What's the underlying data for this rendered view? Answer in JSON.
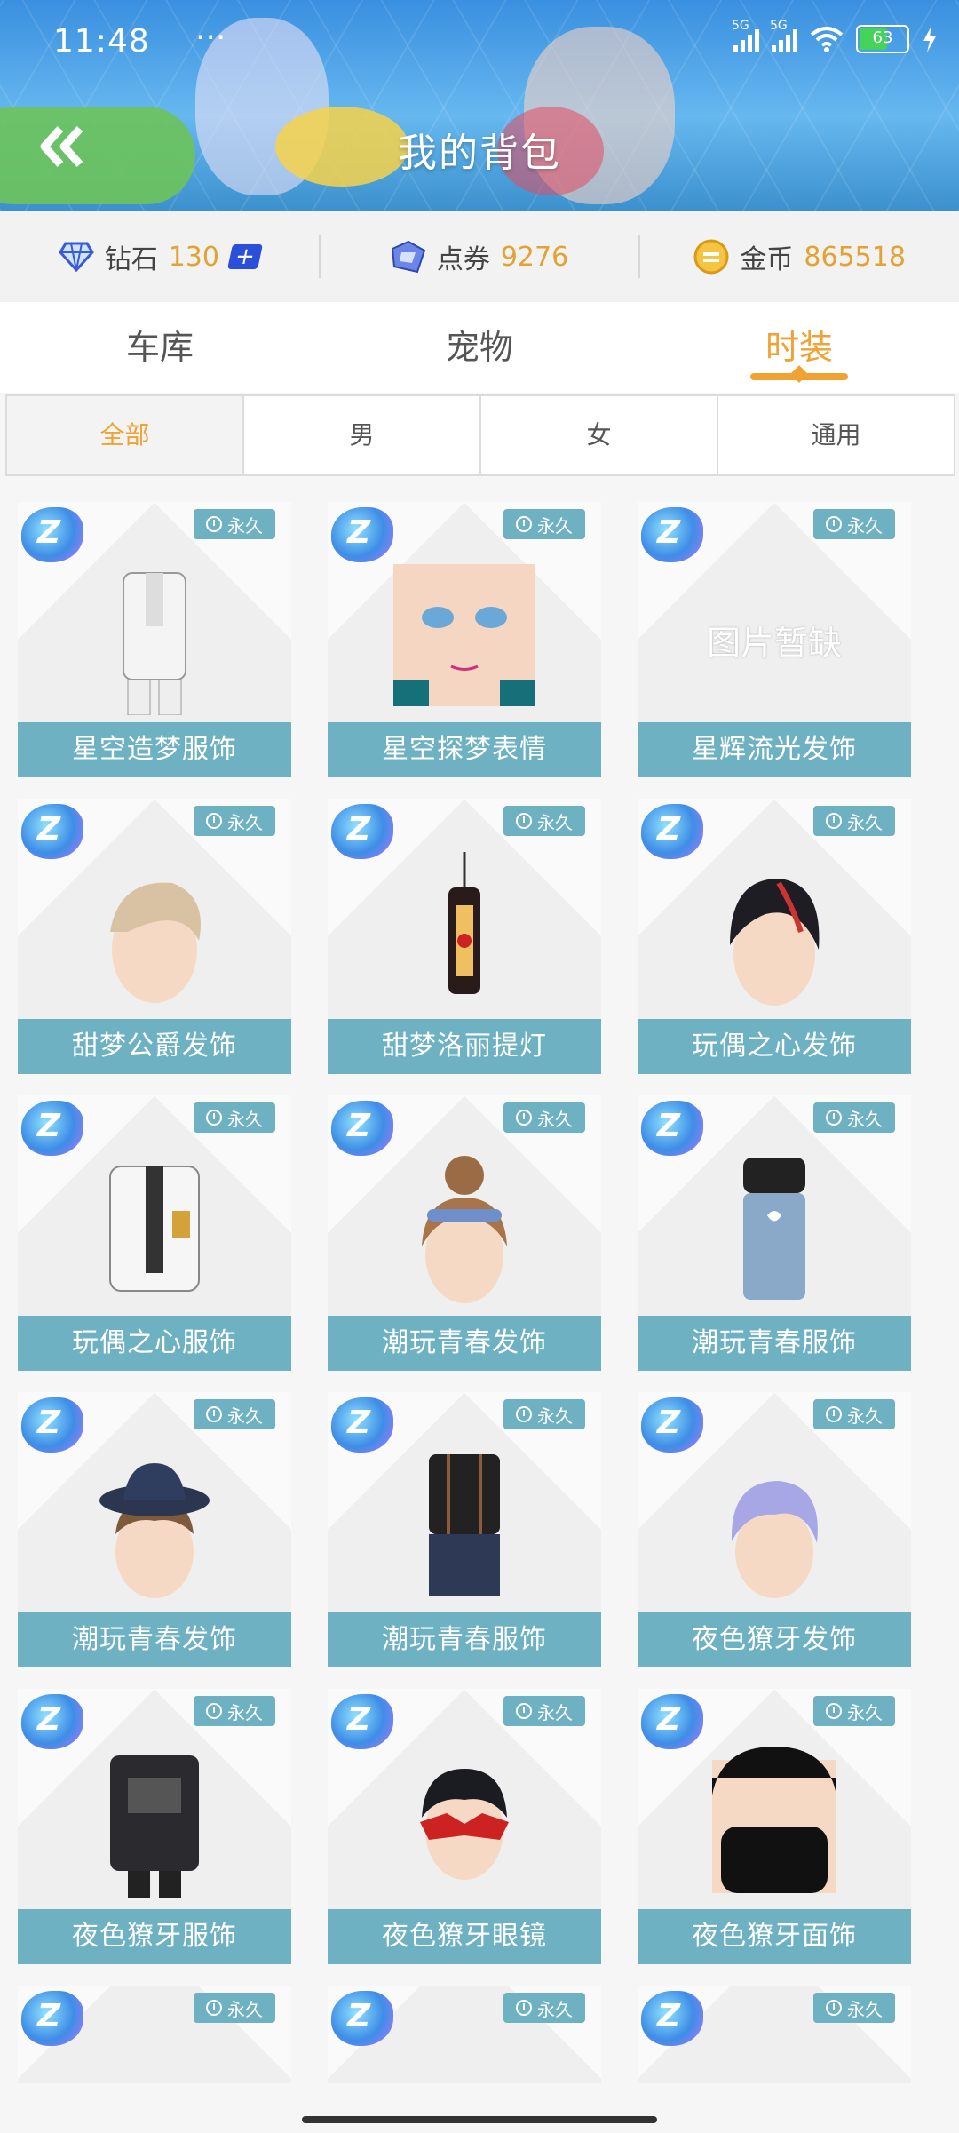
{
  "status": {
    "time": "11:48",
    "dots": "···",
    "sig1": "5G",
    "sig2": "5G",
    "battery": "63"
  },
  "header": {
    "title": "我的背包"
  },
  "currency": [
    {
      "label": "钻石",
      "value": "130"
    },
    {
      "label": "点券",
      "value": "9276"
    },
    {
      "label": "金币",
      "value": "865518"
    }
  ],
  "tabs": [
    "车库",
    "宠物",
    "时装"
  ],
  "filters": [
    "全部",
    "男",
    "女",
    "通用"
  ],
  "perm_label": "永久",
  "na_text": "图片暂缺",
  "items": [
    {
      "name": "星空造梦服饰",
      "kind": "outfit-white"
    },
    {
      "name": "星空探梦表情",
      "kind": "face"
    },
    {
      "name": "星辉流光发饰",
      "kind": "missing"
    },
    {
      "name": "甜梦公爵发饰",
      "kind": "hair-beige"
    },
    {
      "name": "甜梦洛丽提灯",
      "kind": "lantern"
    },
    {
      "name": "玩偶之心发饰",
      "kind": "hair-black"
    },
    {
      "name": "玩偶之心服饰",
      "kind": "outfit-coat"
    },
    {
      "name": "潮玩青春发饰",
      "kind": "hair-bun"
    },
    {
      "name": "潮玩青春服饰",
      "kind": "overalls"
    },
    {
      "name": "潮玩青春发饰",
      "kind": "hat"
    },
    {
      "name": "潮玩青春服饰",
      "kind": "shirt-dark"
    },
    {
      "name": "夜色獠牙发饰",
      "kind": "hair-lilac"
    },
    {
      "name": "夜色獠牙服饰",
      "kind": "jacket"
    },
    {
      "name": "夜色獠牙眼镜",
      "kind": "mask-eyes"
    },
    {
      "name": "夜色獠牙面饰",
      "kind": "mask-face"
    },
    {
      "name": "",
      "kind": "partial"
    },
    {
      "name": "",
      "kind": "partial"
    },
    {
      "name": "",
      "kind": "partial"
    }
  ]
}
